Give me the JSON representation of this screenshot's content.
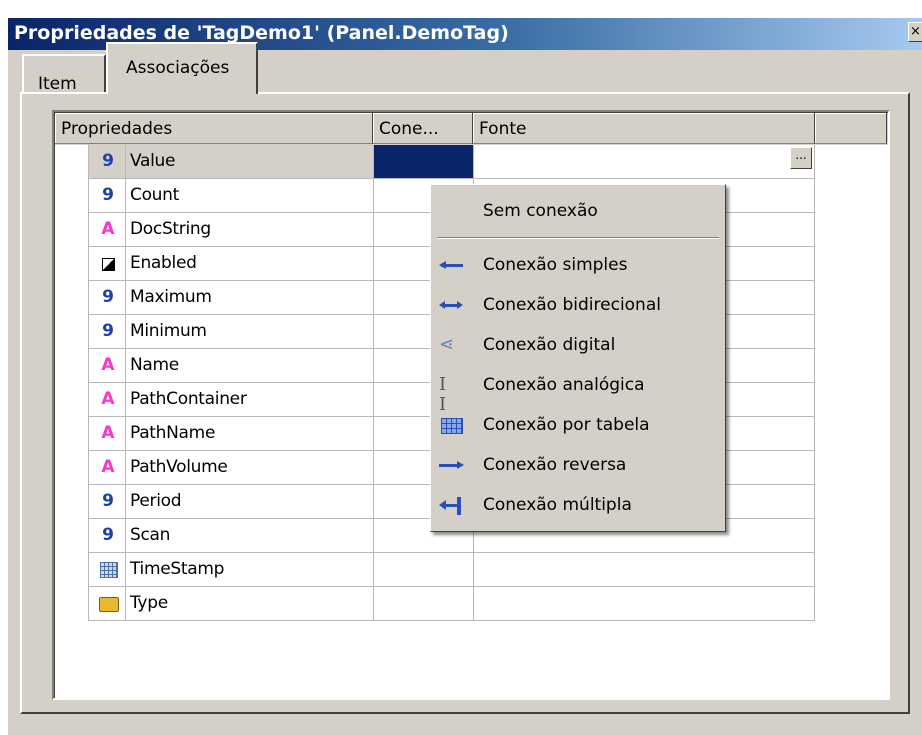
{
  "window": {
    "title": "Propriedades de 'TagDemo1' (Panel.DemoTag)",
    "close_glyph": "×"
  },
  "tabs": [
    {
      "label": "Item",
      "active": false
    },
    {
      "label": "Associações",
      "active": true
    }
  ],
  "grid": {
    "columns": [
      "Propriedades",
      "Cone...",
      "Fonte"
    ],
    "rows": [
      {
        "icon": "number-icon",
        "glyph": "9",
        "name": "Value",
        "selected": true
      },
      {
        "icon": "number-icon",
        "glyph": "9",
        "name": "Count"
      },
      {
        "icon": "string-icon",
        "glyph": "A",
        "name": "DocString"
      },
      {
        "icon": "boolean-icon",
        "glyph": "",
        "name": "Enabled"
      },
      {
        "icon": "number-icon",
        "glyph": "9",
        "name": "Maximum"
      },
      {
        "icon": "number-icon",
        "glyph": "9",
        "name": "Minimum"
      },
      {
        "icon": "string-icon",
        "glyph": "A",
        "name": "Name"
      },
      {
        "icon": "string-icon",
        "glyph": "A",
        "name": "PathContainer"
      },
      {
        "icon": "string-icon",
        "glyph": "A",
        "name": "PathName"
      },
      {
        "icon": "string-icon",
        "glyph": "A",
        "name": "PathVolume"
      },
      {
        "icon": "number-icon",
        "glyph": "9",
        "name": "Period"
      },
      {
        "icon": "number-icon",
        "glyph": "9",
        "name": "Scan"
      },
      {
        "icon": "timestamp-icon",
        "glyph": "",
        "name": "TimeStamp"
      },
      {
        "icon": "type-icon",
        "glyph": "",
        "name": "Type"
      }
    ],
    "ellipsis": "..."
  },
  "context_menu": {
    "top_item": "Sem conexão",
    "items": [
      {
        "label": "Conexão simples",
        "icon": "arrow-left-icon"
      },
      {
        "label": "Conexão bidirecional",
        "icon": "arrow-both-icon"
      },
      {
        "label": "Conexão digital",
        "icon": "digital-icon"
      },
      {
        "label": "Conexão analógica",
        "icon": "analog-icon"
      },
      {
        "label": "Conexão por tabela",
        "icon": "table-icon"
      },
      {
        "label": "Conexão reversa",
        "icon": "arrow-right-icon"
      },
      {
        "label": "Conexão múltipla",
        "icon": "multiple-icon"
      }
    ]
  },
  "colors": {
    "selection": "#0a246a",
    "dialog_bg": "#d4d0c8",
    "number_icon": "#1a3fb0",
    "string_icon": "#ff33cc"
  }
}
